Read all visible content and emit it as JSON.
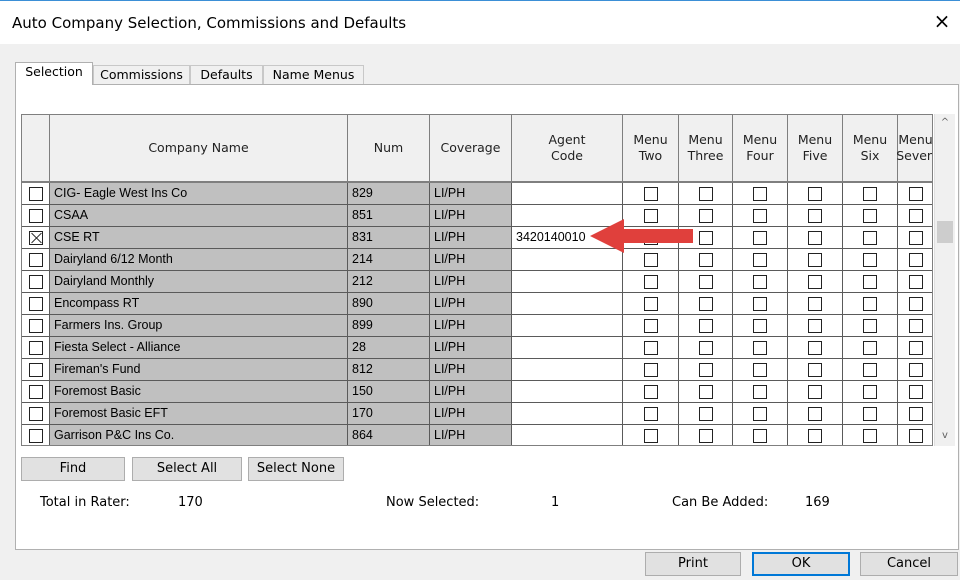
{
  "window": {
    "title": "Auto Company Selection, Commissions and Defaults",
    "close_icon": "×"
  },
  "tabs": [
    "Selection",
    "Commissions",
    "Defaults",
    "Name Menus"
  ],
  "grid": {
    "headers": [
      "Company Name",
      "Num",
      "Coverage",
      "Agent\nCode",
      "Menu\nTwo",
      "Menu\nThree",
      "Menu\nFour",
      "Menu\nFive",
      "Menu\nSix",
      "Menu\nSeven"
    ],
    "rows": [
      {
        "selected": false,
        "company": "CIG- Eagle West Ins Co",
        "num": "829",
        "coverage": "LI/PH",
        "agent_code": ""
      },
      {
        "selected": false,
        "company": "CSAA",
        "num": "851",
        "coverage": "LI/PH",
        "agent_code": ""
      },
      {
        "selected": true,
        "company": "CSE RT",
        "num": "831",
        "coverage": "LI/PH",
        "agent_code": "3420140010"
      },
      {
        "selected": false,
        "company": "Dairyland 6/12 Month",
        "num": "214",
        "coverage": "LI/PH",
        "agent_code": ""
      },
      {
        "selected": false,
        "company": "Dairyland Monthly",
        "num": "212",
        "coverage": "LI/PH",
        "agent_code": ""
      },
      {
        "selected": false,
        "company": "Encompass RT",
        "num": "890",
        "coverage": "LI/PH",
        "agent_code": ""
      },
      {
        "selected": false,
        "company": "Farmers Ins. Group",
        "num": "899",
        "coverage": "LI/PH",
        "agent_code": ""
      },
      {
        "selected": false,
        "company": "Fiesta Select - Alliance",
        "num": "28",
        "coverage": "LI/PH",
        "agent_code": ""
      },
      {
        "selected": false,
        "company": "Fireman's Fund",
        "num": "812",
        "coverage": "LI/PH",
        "agent_code": ""
      },
      {
        "selected": false,
        "company": "Foremost Basic",
        "num": "150",
        "coverage": "LI/PH",
        "agent_code": ""
      },
      {
        "selected": false,
        "company": "Foremost Basic EFT",
        "num": "170",
        "coverage": "LI/PH",
        "agent_code": ""
      },
      {
        "selected": false,
        "company": "Garrison P&C Ins Co.",
        "num": "864",
        "coverage": "LI/PH",
        "agent_code": ""
      }
    ],
    "scroll_up_icon": "^",
    "scroll_down_icon": "v"
  },
  "buttons": {
    "find": "Find",
    "select_all": "Select All",
    "select_none": "Select None",
    "print": "Print",
    "ok": "OK",
    "cancel": "Cancel"
  },
  "stats": {
    "total_label": "Total in Rater:",
    "total_value": "170",
    "selected_label": "Now Selected:",
    "selected_value": "1",
    "addable_label": "Can Be Added:",
    "addable_value": "169"
  },
  "colors": {
    "annotation_arrow": "#e0403c",
    "accent": "#0078d7",
    "locked_cell": "#c0c0c0"
  }
}
